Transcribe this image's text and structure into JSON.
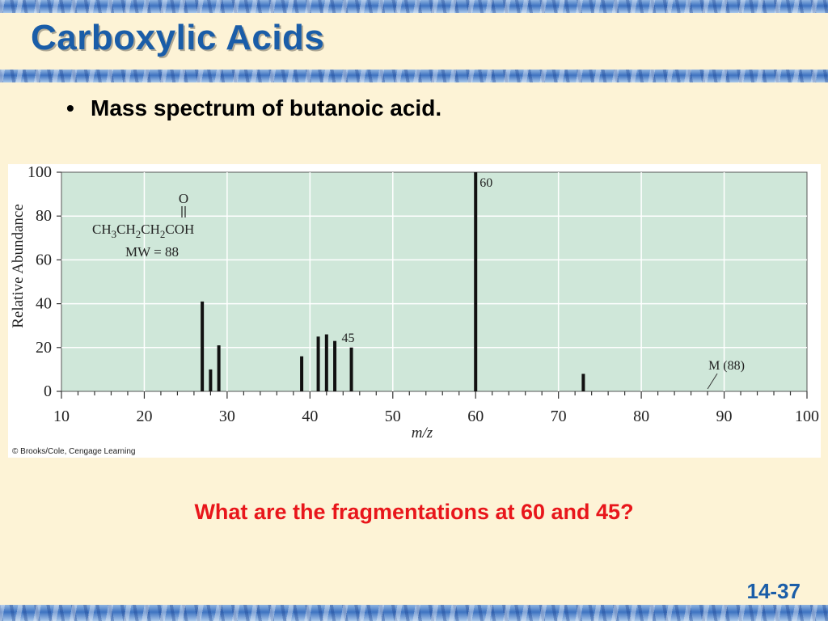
{
  "slide": {
    "title": "Carboxylic Acids",
    "bullet": "Mass spectrum of butanoic acid.",
    "question": "What are the fragmentations at 60 and 45?",
    "slide_number": "14-37",
    "credit": "© Brooks/Cole, Cengage Learning"
  },
  "molecule": {
    "oxygen": "O",
    "parts": [
      {
        "t": "CH",
        "sub": false
      },
      {
        "t": "3",
        "sub": true
      },
      {
        "t": "CH",
        "sub": false
      },
      {
        "t": "2",
        "sub": true
      },
      {
        "t": "CH",
        "sub": false
      },
      {
        "t": "2",
        "sub": true
      },
      {
        "t": "COH",
        "sub": false
      }
    ],
    "mw": "MW = 88"
  },
  "colors": {
    "plot_bg": "#cfe7d9",
    "title_blue": "#1a5da8",
    "question_red": "#e8161b"
  },
  "chart_data": {
    "type": "bar",
    "title": "",
    "xlabel": "m/z",
    "ylabel": "Relative Abundance",
    "xlim": [
      10,
      100
    ],
    "ylim": [
      0,
      100
    ],
    "x_ticks": [
      "10",
      "20",
      "30",
      "40",
      "50",
      "60",
      "70",
      "80",
      "90",
      "100"
    ],
    "y_ticks": [
      "0",
      "20",
      "40",
      "60",
      "80",
      "100"
    ],
    "grid": true,
    "peaks": [
      {
        "mz": 27,
        "abundance": 41
      },
      {
        "mz": 28,
        "abundance": 10
      },
      {
        "mz": 29,
        "abundance": 21
      },
      {
        "mz": 39,
        "abundance": 16
      },
      {
        "mz": 41,
        "abundance": 25
      },
      {
        "mz": 42,
        "abundance": 26
      },
      {
        "mz": 43,
        "abundance": 23
      },
      {
        "mz": 45,
        "abundance": 20
      },
      {
        "mz": 60,
        "abundance": 100
      },
      {
        "mz": 73,
        "abundance": 8
      }
    ],
    "annotations": [
      {
        "text": "60",
        "mz": 60
      },
      {
        "text": "45",
        "mz": 45
      },
      {
        "text": "M (88)",
        "mz": 88
      }
    ]
  }
}
